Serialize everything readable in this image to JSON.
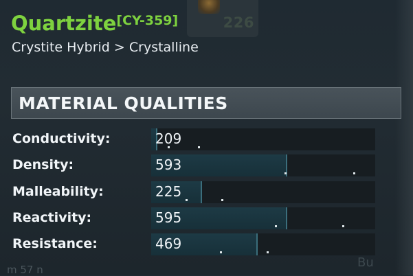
{
  "item": {
    "name": "Quartzite",
    "code": "[CY-359]",
    "category": "Crystite Hybrid > Crystalline",
    "stack_count": "226",
    "name_color": "#7ed23f"
  },
  "section": {
    "title": "MATERIAL QUALITIES"
  },
  "qualities": [
    {
      "label": "Conductivity:",
      "value": "209",
      "fill_fraction": 0.02
    },
    {
      "label": "Density:",
      "value": "593",
      "fill_fraction": 0.6
    },
    {
      "label": "Malleability:",
      "value": "225",
      "fill_fraction": 0.22
    },
    {
      "label": "Reactivity:",
      "value": "595",
      "fill_fraction": 0.6
    },
    {
      "label": "Resistance:",
      "value": "469",
      "fill_fraction": 0.47
    }
  ],
  "footer": {
    "left_text": "m 57 n",
    "right_text": "Bu"
  },
  "colors": {
    "bar_fill": "#1d3a45",
    "bar_track": "#171d21",
    "header_bg": "#454f56"
  }
}
